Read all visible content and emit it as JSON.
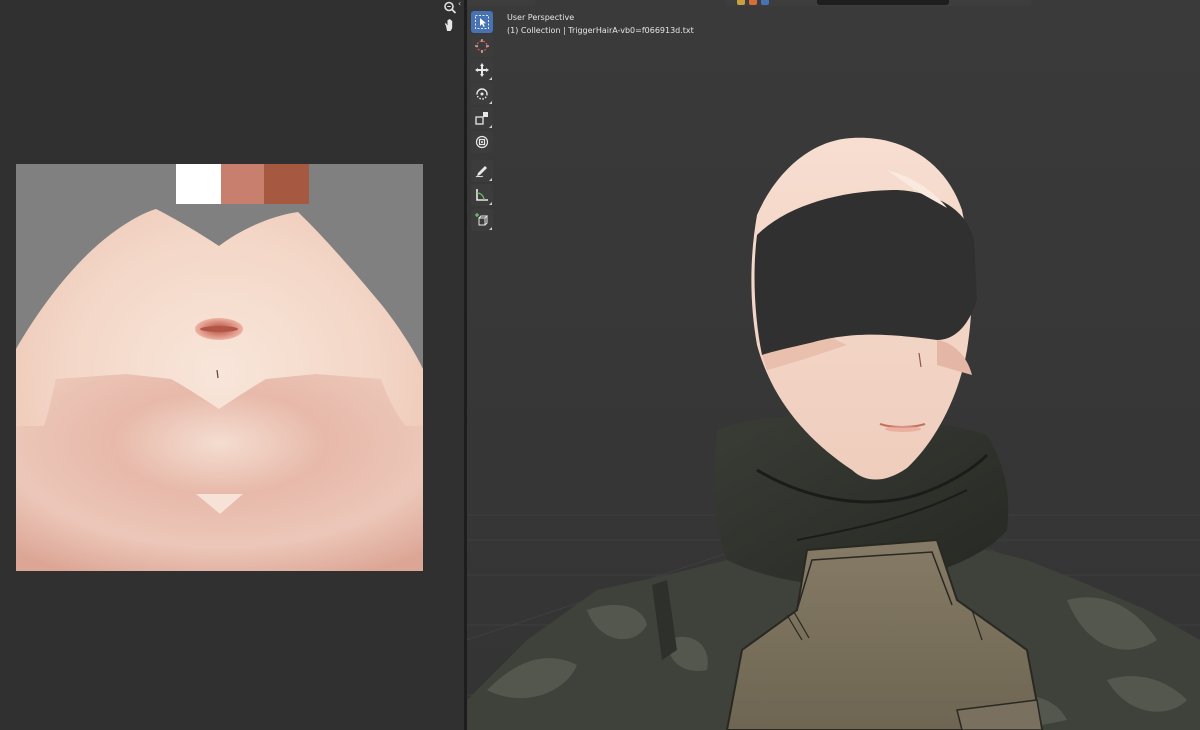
{
  "viewport": {
    "view_name": "User Perspective",
    "collection_info": "(1) Collection | TriggerHairA-vb0=f066913d.txt",
    "search": {
      "placeholder": ""
    }
  },
  "toolbar": {
    "tools": [
      {
        "icon": "select-box-icon",
        "active": true
      },
      {
        "icon": "cursor-icon",
        "active": false
      },
      {
        "icon": "move-icon",
        "active": false
      },
      {
        "icon": "rotate-icon",
        "active": false
      },
      {
        "icon": "scale-icon",
        "active": false
      },
      {
        "icon": "transform-icon",
        "active": false
      },
      {
        "icon": "annotate-icon",
        "active": false
      },
      {
        "icon": "measure-icon",
        "active": false
      },
      {
        "icon": "add-cube-icon",
        "active": false
      }
    ]
  },
  "uv_editor": {
    "nav": [
      "zoom-icon",
      "hand-pan-icon"
    ],
    "palette": [
      "#ffffff",
      "#c97f6e",
      "#a65840"
    ]
  },
  "colors": {
    "skin_light": "#f6dccd",
    "skin_shadow": "#deaa9a",
    "lip": "#c97f6e",
    "background_uv": "#808080",
    "viewport_bg": "#3a3a3a",
    "active_tool": "#4772b3"
  }
}
